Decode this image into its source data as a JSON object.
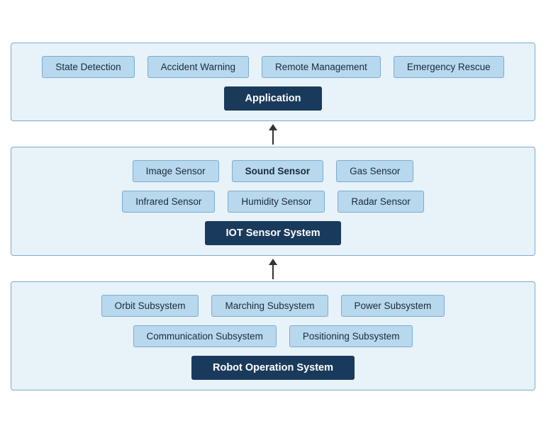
{
  "diagram": {
    "tiers": [
      {
        "id": "application-tier",
        "rows": [
          [
            "State Detection",
            "Accident Warning",
            "Remote Management",
            "Emergency Rescue"
          ]
        ],
        "mainLabel": "Application"
      },
      {
        "id": "sensor-tier",
        "rows": [
          [
            "Image Sensor",
            "Sound Sensor",
            "Gas Sensor"
          ],
          [
            "Infrared Sensor",
            "Humidity Sensor",
            "Radar Sensor"
          ]
        ],
        "mainLabel": "IOT Sensor System",
        "soundSensorBold": true
      },
      {
        "id": "robot-tier",
        "rows": [
          [
            "Orbit Subsystem",
            "Marching Subsystem",
            "Power Subsystem"
          ],
          [
            "Communication Subsystem",
            "Positioning Subsystem"
          ]
        ],
        "mainLabel": "Robot Operation System"
      }
    ]
  }
}
